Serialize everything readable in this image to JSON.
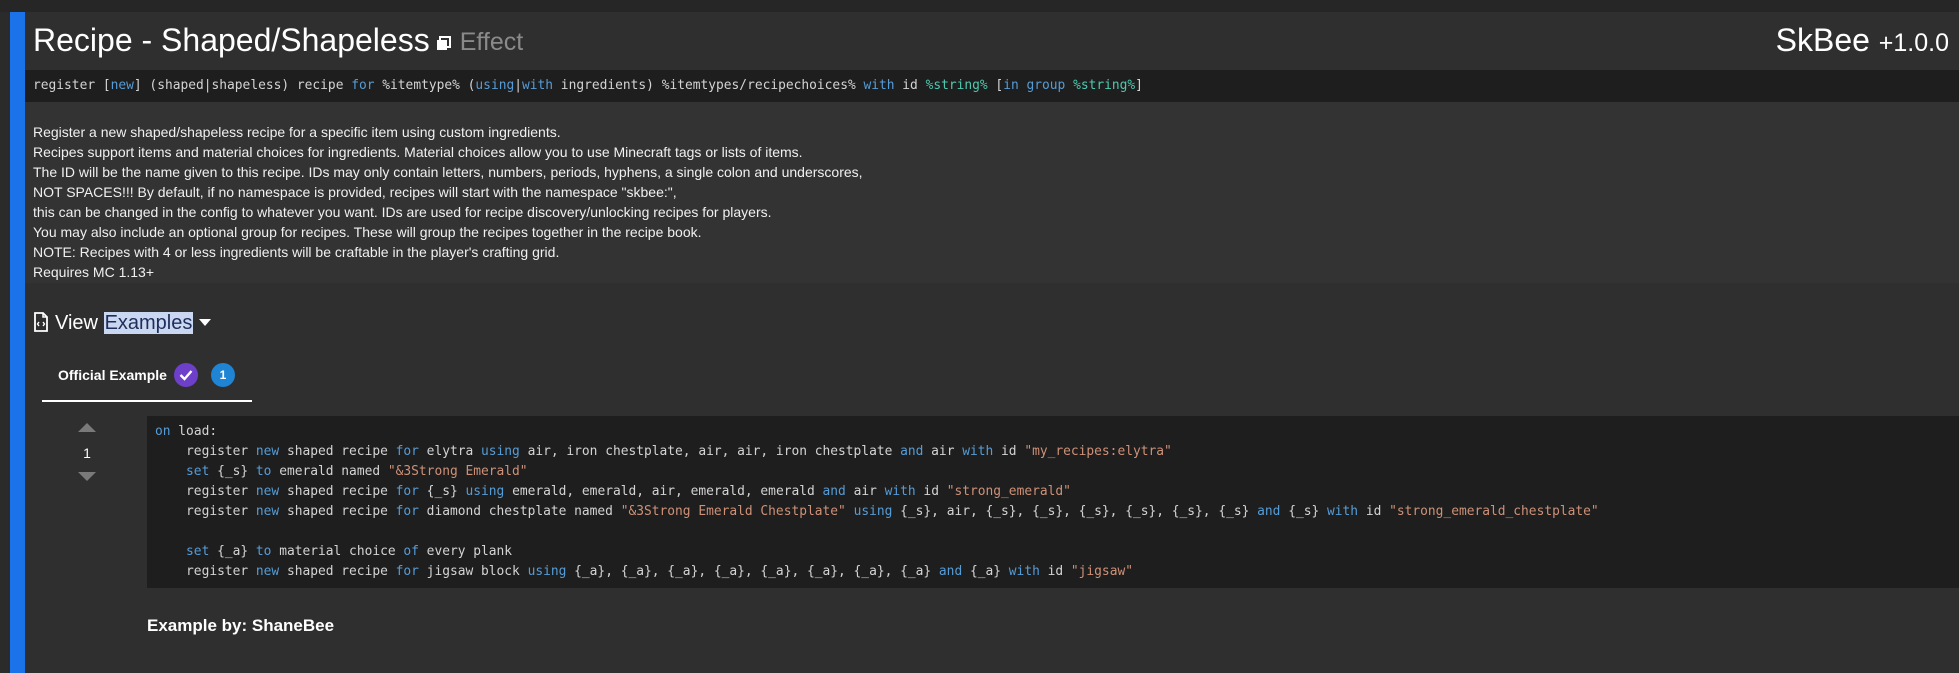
{
  "header": {
    "title": "Recipe - Shaped/Shapeless",
    "type_label": "Effect",
    "addon_name": "SkBee",
    "addon_version": "+1.0.0"
  },
  "syntax": {
    "p1": "register [",
    "k1": "new",
    "p2": "] (shaped|shapeless) recipe ",
    "k2": "for",
    "p3": " %itemtype% (",
    "k3": "using",
    "p4": "|",
    "k4": "with",
    "p5": " ingredients) %itemtypes/recipechoices% ",
    "k5": "with",
    "p6": " id ",
    "t1": "%string%",
    "p7": " [",
    "k6": "in",
    "p8": " ",
    "k7": "group",
    "p9": " ",
    "t2": "%string%",
    "p10": "]"
  },
  "description": [
    "Register a new shaped/shapeless recipe for a specific item using custom ingredients.",
    "Recipes support items and material choices for ingredients. Material choices allow you to use Minecraft tags or lists of items.",
    "The ID will be the name given to this recipe. IDs may only contain letters, numbers, periods, hyphens, a single colon and underscores,",
    "NOT SPACES!!! By default, if no namespace is provided, recipes will start with the namespace \"skbee:\",",
    "this can be changed in the config to whatever you want. IDs are used for recipe discovery/unlocking recipes for players.",
    "You may also include an optional group for recipes. These will group the recipes together in the recipe book.",
    "NOTE: Recipes with 4 or less ingredients will be craftable in the player's crafting grid.",
    "Requires MC 1.13+"
  ],
  "examples": {
    "view_label": "View",
    "examples_label": "Examples",
    "tab_label": "Official Example",
    "tab_count": "1",
    "vote_count": "1",
    "author": "Example by: ShaneBee"
  },
  "code": {
    "l1_a": "on",
    "l1_b": " load:",
    "l2_a": "    register ",
    "l2_k1": "new",
    "l2_b": " shaped recipe ",
    "l2_k2": "for",
    "l2_c": " elytra ",
    "l2_k3": "using",
    "l2_d": " air, iron chestplate, air, air, iron chestplate ",
    "l2_k4": "and",
    "l2_e": " air ",
    "l2_k5": "with",
    "l2_f": " id ",
    "l2_s": "\"my_recipes:elytra\"",
    "l3_a": "    ",
    "l3_k1": "set",
    "l3_b": " {_s} ",
    "l3_k2": "to",
    "l3_c": " emerald named ",
    "l3_s": "\"&3Strong Emerald\"",
    "l4_a": "    register ",
    "l4_k1": "new",
    "l4_b": " shaped recipe ",
    "l4_k2": "for",
    "l4_c": " {_s} ",
    "l4_k3": "using",
    "l4_d": " emerald, emerald, air, emerald, emerald ",
    "l4_k4": "and",
    "l4_e": " air ",
    "l4_k5": "with",
    "l4_f": " id ",
    "l4_s": "\"strong_emerald\"",
    "l5_a": "    register ",
    "l5_k1": "new",
    "l5_b": " shaped recipe ",
    "l5_k2": "for",
    "l5_c": " diamond chestplate named ",
    "l5_s1": "\"&3Strong Emerald Chestplate\"",
    "l5_d": " ",
    "l5_k3": "using",
    "l5_e": " {_s}, air, {_s}, {_s}, {_s}, {_s}, {_s}, {_s} ",
    "l5_k4": "and",
    "l5_f": " {_s} ",
    "l5_k5": "with",
    "l5_g": " id ",
    "l5_s2": "\"strong_emerald_chestplate\"",
    "l7_a": "    ",
    "l7_k1": "set",
    "l7_b": " {_a} ",
    "l7_k2": "to",
    "l7_c": " material choice ",
    "l7_k3": "of",
    "l7_d": " every plank",
    "l8_a": "    register ",
    "l8_k1": "new",
    "l8_b": " shaped recipe ",
    "l8_k2": "for",
    "l8_c": " jigsaw block ",
    "l8_k3": "using",
    "l8_d": " {_a}, {_a}, {_a}, {_a}, {_a}, {_a}, {_a}, {_a} ",
    "l8_k4": "and",
    "l8_e": " {_a} ",
    "l8_k5": "with",
    "l8_f": " id ",
    "l8_s": "\"jigsaw\""
  }
}
